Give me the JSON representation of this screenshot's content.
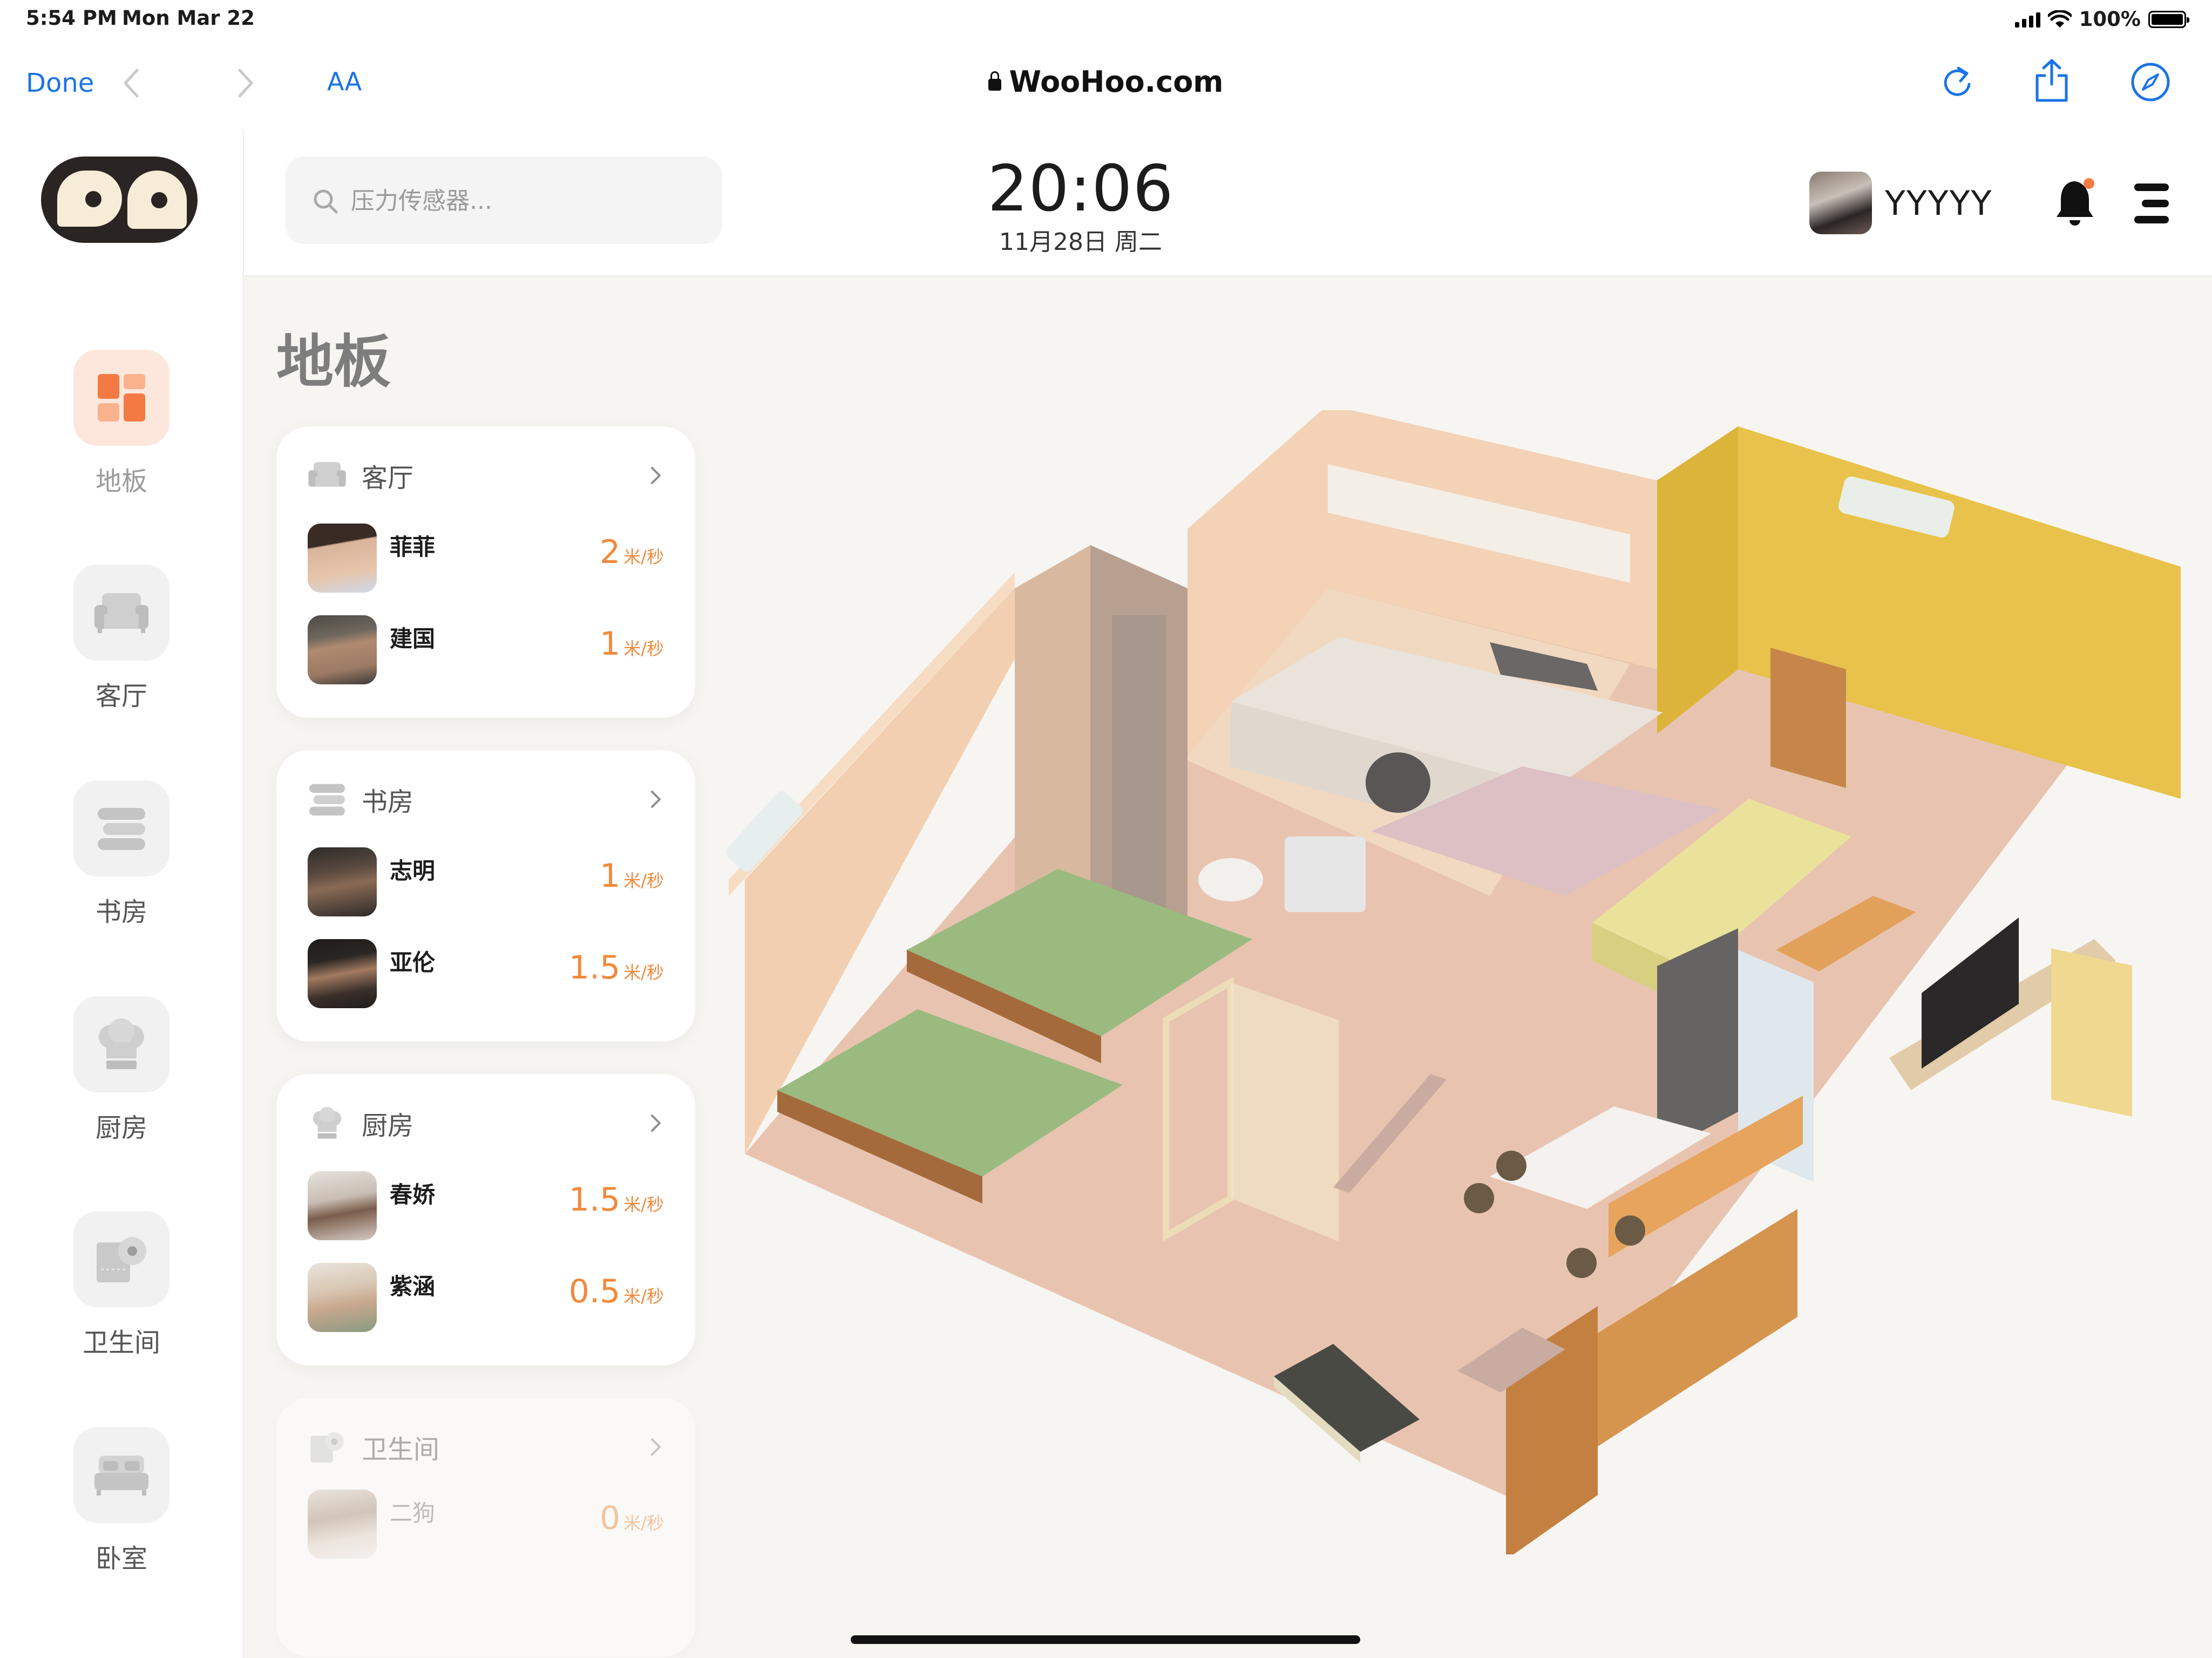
{
  "status_bar": {
    "time": "5:54 PM",
    "date": "Mon Mar 22",
    "battery": "100%"
  },
  "browser": {
    "done": "Done",
    "text_size": "AA",
    "url": "WooHoo.com"
  },
  "header": {
    "search_placeholder": "压力传感器...",
    "time": "20:06",
    "date": "11月28日 周二",
    "user_name": "YYYYY"
  },
  "nav": [
    {
      "label": "地板",
      "icon": "floor-grid-icon",
      "active": true
    },
    {
      "label": "客厅",
      "icon": "sofa-icon"
    },
    {
      "label": "书房",
      "icon": "books-icon"
    },
    {
      "label": "厨房",
      "icon": "chef-hat-icon"
    },
    {
      "label": "卫生间",
      "icon": "toilet-paper-icon"
    },
    {
      "label": "卧室",
      "icon": "bed-icon"
    }
  ],
  "main": {
    "title": "地板",
    "rooms": [
      {
        "name": "客厅",
        "icon": "sofa-icon",
        "members": [
          {
            "name": "菲菲",
            "speed": "2",
            "unit": "米/秒"
          },
          {
            "name": "建国",
            "speed": "1",
            "unit": "米/秒"
          }
        ]
      },
      {
        "name": "书房",
        "icon": "books-icon",
        "members": [
          {
            "name": "志明",
            "speed": "1",
            "unit": "米/秒"
          },
          {
            "name": "亚伦",
            "speed": "1.5",
            "unit": "米/秒"
          }
        ]
      },
      {
        "name": "厨房",
        "icon": "chef-hat-icon",
        "members": [
          {
            "name": "春娇",
            "speed": "1.5",
            "unit": "米/秒"
          },
          {
            "name": "紫涵",
            "speed": "0.5",
            "unit": "米/秒"
          }
        ]
      },
      {
        "name": "卫生间",
        "icon": "toilet-paper-icon",
        "members": [
          {
            "name": "二狗",
            "speed": "0",
            "unit": "米/秒"
          }
        ]
      }
    ]
  },
  "colors": {
    "accent": "#f08a3c",
    "link": "#1a73e8",
    "active_nav_bg": "#fde7dd"
  }
}
